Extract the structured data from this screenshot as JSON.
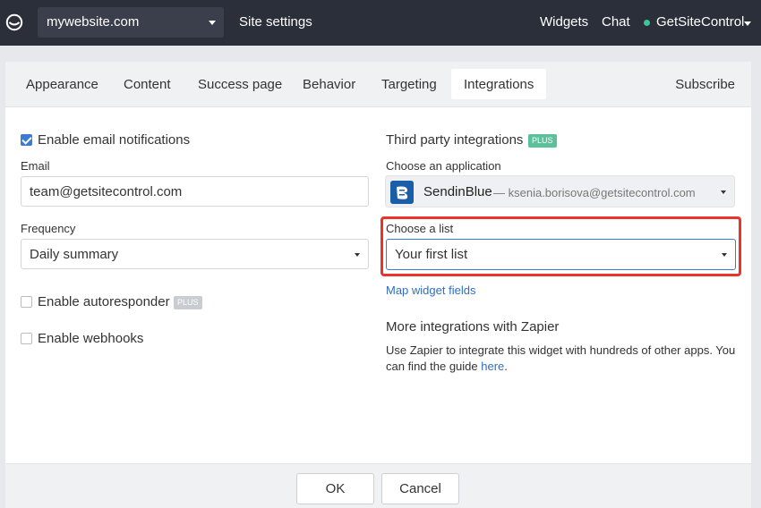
{
  "topbar": {
    "site": "mywebsite.com",
    "site_settings": "Site settings",
    "widgets": "Widgets",
    "chat": "Chat",
    "account": "GetSiteControl",
    "status_color": "#3dc49a"
  },
  "tabs": [
    "Appearance",
    "Content",
    "Success page",
    "Behavior",
    "Targeting",
    "Integrations"
  ],
  "active_tab": "Integrations",
  "tab_right": "Subscribe",
  "left": {
    "enable_email_label": "Enable email notifications",
    "enable_email_checked": true,
    "email_label": "Email",
    "email_value": "team@getsitecontrol.com",
    "frequency_label": "Frequency",
    "frequency_value": "Daily summary",
    "autoresponder_label": "Enable autoresponder",
    "autoresponder_badge": "PLUS",
    "webhooks_label": "Enable webhooks"
  },
  "right": {
    "third_party_title": "Third party integrations",
    "third_party_badge": "PLUS",
    "choose_app_label": "Choose an application",
    "app_name": "SendinBlue",
    "app_account": "— ksenia.borisova@getsitecontrol.com",
    "choose_list_label": "Choose a list",
    "list_value": "Your first list",
    "map_fields_link": "Map widget fields",
    "zapier_title": "More integrations with Zapier",
    "zapier_text": "Use Zapier to integrate this widget with hundreds of other apps. You can find the guide ",
    "zapier_link": "here",
    "zapier_end": "."
  },
  "footer": {
    "ok": "OK",
    "cancel": "Cancel"
  },
  "colors": {
    "accent": "#3a7bd5",
    "highlight": "#e8352a",
    "plus_green": "#5bc19a"
  }
}
